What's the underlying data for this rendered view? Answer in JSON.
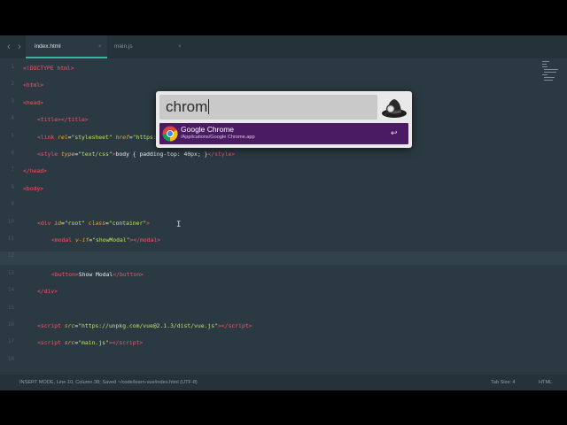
{
  "tabs": [
    {
      "label": "index.html",
      "close": "×",
      "active": true
    },
    {
      "label": "main.js",
      "close": "×",
      "active": false
    }
  ],
  "nav": {
    "back": "‹",
    "forward": "›"
  },
  "line_numbers": [
    "1",
    "2",
    "3",
    "4",
    "5",
    "6",
    "7",
    "8",
    "9",
    "10",
    "11",
    "12",
    "13",
    "14",
    "15",
    "16",
    "17",
    "18"
  ],
  "code_lines": [
    {
      "indent": 0,
      "html": "<span class='tg'>&lt;!DOCTYPE html&gt;</span>"
    },
    {
      "indent": 0,
      "html": "<span class='tg'>&lt;html&gt;</span>"
    },
    {
      "indent": 0,
      "html": "<span class='tg'>&lt;head&gt;</span>"
    },
    {
      "indent": 1,
      "html": "<span class='tg'>&lt;title&gt;&lt;/title&gt;</span>"
    },
    {
      "indent": 1,
      "html": "<span class='tg'>&lt;link </span><span class='at'>rel</span><span class='tx'>=</span><span class='st'>\"stylesheet\"</span><span class='tx'> </span><span class='at'>href</span><span class='tx'>=</span><span class='st'>\"https://unpkg.com/bulma/css/bulma.css\"</span><span class='tg'>&gt;</span>"
    },
    {
      "indent": 1,
      "html": "<span class='tg'>&lt;style </span><span class='at'>type</span><span class='tx'>=</span><span class='st'>\"text/css\"</span><span class='tg'>&gt;</span><span class='tx'>body { padding-top: 40px; }</span><span class='tg'>&lt;/style&gt;</span>"
    },
    {
      "indent": 0,
      "html": "<span class='tg'>&lt;/head&gt;</span>"
    },
    {
      "indent": 0,
      "html": "<span class='tg'>&lt;body&gt;</span>"
    },
    {
      "indent": 0,
      "html": ""
    },
    {
      "indent": 1,
      "html": "<span class='tg'>&lt;div </span><span class='at'>id</span><span class='tx'>=</span><span class='st'>\"root\"</span><span class='tx'> </span><span class='at'>class</span><span class='tx'>=</span><span class='st'>\"container\"</span><span class='tg'>&gt;</span>"
    },
    {
      "indent": 2,
      "html": "<span class='tg'>&lt;modal </span><span class='at'>v-if</span><span class='tx'>=</span><span class='st'>\"showModal\"</span><span class='tg'>&gt;&lt;/modal&gt;</span>"
    },
    {
      "indent": 0,
      "html": ""
    },
    {
      "indent": 2,
      "html": "<span class='tg'>&lt;button&gt;</span><span class='tx'>Show Modal</span><span class='tg'>&lt;/button&gt;</span>"
    },
    {
      "indent": 1,
      "html": "<span class='tg'>&lt;/div&gt;</span>"
    },
    {
      "indent": 0,
      "html": ""
    },
    {
      "indent": 1,
      "html": "<span class='tg'>&lt;script </span><span class='at'>src</span><span class='tx'>=</span><span class='st'>\"https://unpkg.com/vue@2.1.3/dist/vue.js\"</span><span class='tg'>&gt;&lt;/script&gt;</span>"
    },
    {
      "indent": 1,
      "html": "<span class='tg'>&lt;script </span><span class='at'>src</span><span class='tx'>=</span><span class='st'>\"main.js\"</span><span class='tg'>&gt;&lt;/script&gt;</span>"
    },
    {
      "indent": 0,
      "html": ""
    }
  ],
  "status": {
    "left": "INSERT MODE, Line 10, Column 38; Saved ~/code/learn-vue/index.html (UTF-8)",
    "tab_size": "Tab Size: 4",
    "syntax": "HTML"
  },
  "launcher": {
    "query": "chrom",
    "icon": "alfred-hat-icon",
    "result": {
      "title": "Google Chrome",
      "subtitle": "/Applications/Google Chrome.app",
      "action_key": "↩",
      "icon": "chrome-icon"
    }
  },
  "colors": {
    "editor_bg": "#2b3a42",
    "tag": "#f0576a",
    "attribute": "#f5a623",
    "string": "#bfe06a",
    "tab_accent": "#37b5a3",
    "result_highlight": "#4a1a63"
  }
}
